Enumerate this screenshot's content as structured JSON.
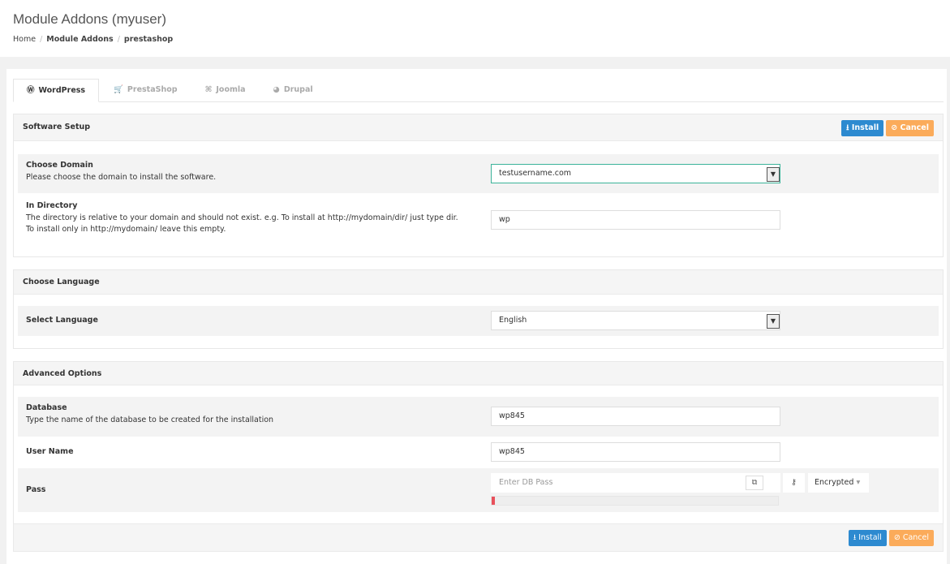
{
  "header": {
    "title": "Module Addons (myuser)",
    "breadcrumb": [
      "Home",
      "Module Addons",
      "prestashop"
    ],
    "sep": "/"
  },
  "tabs": [
    {
      "label": "WordPress",
      "icon": "wordpress-icon",
      "glyph": "Ⓦ"
    },
    {
      "label": "PrestaShop",
      "icon": "cart-icon",
      "glyph": "🛒"
    },
    {
      "label": "Joomla",
      "icon": "joomla-icon",
      "glyph": "⌘"
    },
    {
      "label": "Drupal",
      "icon": "drupal-icon",
      "glyph": "◕"
    }
  ],
  "buttons": {
    "install": "Install",
    "cancel": "Cancel",
    "install_glyph": "⭳",
    "cancel_glyph": "⊘"
  },
  "software_setup": {
    "title": "Software Setup",
    "domain_label": "Choose Domain",
    "domain_desc": "Please choose the domain to install the software.",
    "domain_value": "testusername.com",
    "dir_label": "In Directory",
    "dir_desc": "The directory is relative to your domain and should not exist. e.g. To install at http://mydomain/dir/ just type dir. To install only in http://mydomain/ leave this empty.",
    "dir_value": "wp"
  },
  "language": {
    "title": "Choose Language",
    "label": "Select Language",
    "value": "English"
  },
  "advanced": {
    "title": "Advanced Options",
    "db_label": "Database",
    "db_desc": "Type the name of the database to be created for the installation",
    "db_value": "wp845",
    "user_label": "User Name",
    "user_value": "wp845",
    "pass_label": "Pass",
    "pass_placeholder": "Enter DB Pass",
    "pass_mode": "Encrypted",
    "strength_percent": 1
  }
}
